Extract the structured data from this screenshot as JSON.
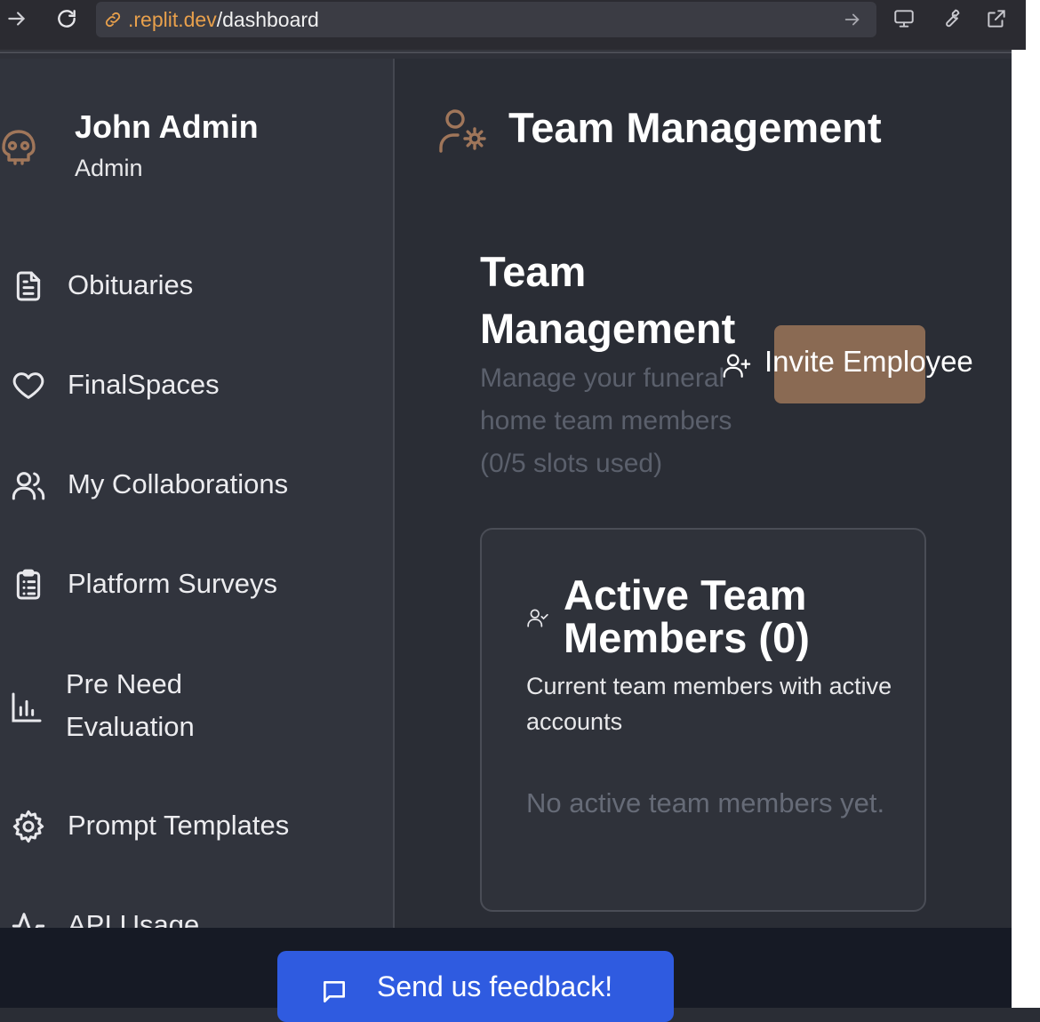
{
  "browser": {
    "url_host": ".replit.dev",
    "url_path": "/dashboard"
  },
  "user": {
    "name": "John Admin",
    "role": "Admin"
  },
  "sidebar": {
    "items": [
      {
        "label": "Obituaries",
        "icon": "document-icon"
      },
      {
        "label": "FinalSpaces",
        "icon": "heart-icon"
      },
      {
        "label": "My Collaborations",
        "icon": "users-icon"
      },
      {
        "label": "Platform Surveys",
        "icon": "clipboard-icon"
      },
      {
        "label": "Pre Need Evaluation",
        "icon": "bar-chart-icon"
      },
      {
        "label": "Prompt Templates",
        "icon": "gear-icon"
      },
      {
        "label": "API Usage",
        "icon": "activity-icon"
      }
    ]
  },
  "main": {
    "header_title": "Team Management",
    "section_title": "Team Management",
    "section_description": "Manage your funeral home team members (0/5 slots used)",
    "invite_button": "Invite Employee",
    "card": {
      "title": "Active Team Members (0)",
      "description": "Current team members with active accounts",
      "empty_text": "No active team members yet."
    }
  },
  "footer": {
    "feedback_button": "Send us feedback!"
  },
  "colors": {
    "accent": "#8a6a53",
    "icon_accent": "#b07a54",
    "feedback": "#2f5be0",
    "url_host": "#e8a04c"
  }
}
